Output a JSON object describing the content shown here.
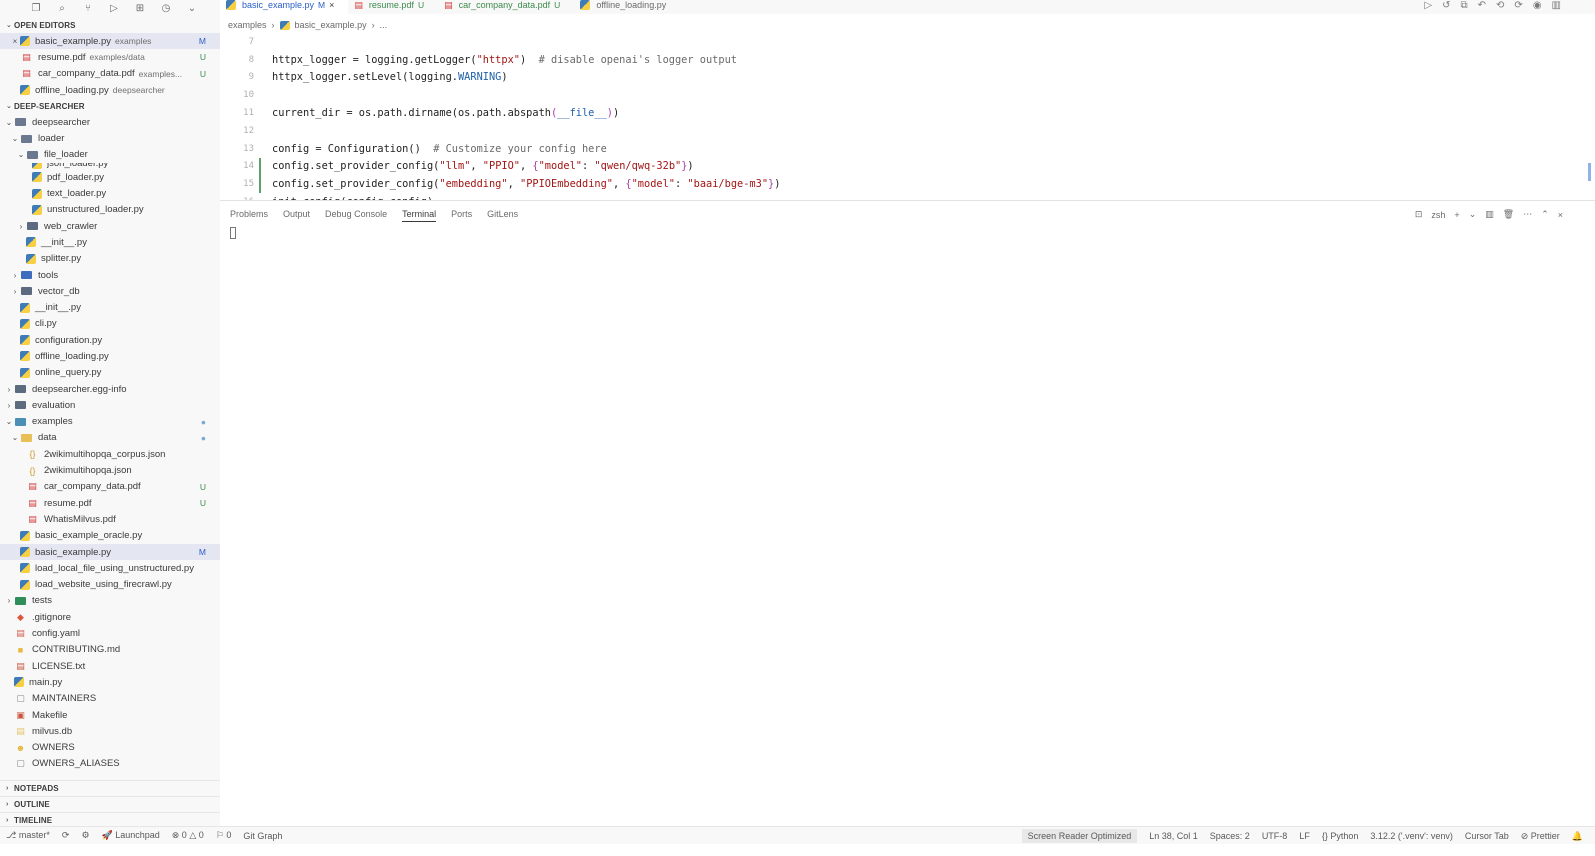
{
  "sidebar": {
    "activity_icons": [
      "copy-icon",
      "search-icon",
      "source-control-icon",
      "run-debug-icon",
      "extensions-icon",
      "timer-icon",
      "chevron-down-icon"
    ],
    "open_editors_title": "OPEN EDITORS",
    "open_editors": [
      {
        "name": "basic_example.py",
        "desc": "examples",
        "badge": "M",
        "status": "modified",
        "icon": "python",
        "close": true,
        "selected": true
      },
      {
        "name": "resume.pdf",
        "desc": "examples/data",
        "badge": "U",
        "status": "untracked",
        "icon": "pdf"
      },
      {
        "name": "car_company_data.pdf",
        "desc": "examples...",
        "badge": "U",
        "status": "untracked",
        "icon": "pdf"
      },
      {
        "name": "offline_loading.py",
        "desc": "deepsearcher",
        "badge": "",
        "status": "normal",
        "icon": "python"
      }
    ],
    "project_title": "DEEP-SEARCHER",
    "tree": [
      {
        "name": "deepsearcher",
        "depth": 0,
        "type": "folder-open"
      },
      {
        "name": "loader",
        "depth": 1,
        "type": "folder-open"
      },
      {
        "name": "file_loader",
        "depth": 2,
        "type": "folder-open"
      },
      {
        "name": "json_loader.py",
        "depth": 3,
        "type": "python",
        "partial": true
      },
      {
        "name": "pdf_loader.py",
        "depth": 3,
        "type": "python"
      },
      {
        "name": "text_loader.py",
        "depth": 3,
        "type": "python"
      },
      {
        "name": "unstructured_loader.py",
        "depth": 3,
        "type": "python"
      },
      {
        "name": "web_crawler",
        "depth": 2,
        "type": "folder"
      },
      {
        "name": "__init__.py",
        "depth": 2,
        "type": "python"
      },
      {
        "name": "splitter.py",
        "depth": 2,
        "type": "python"
      },
      {
        "name": "tools",
        "depth": 1,
        "type": "folder-tools"
      },
      {
        "name": "vector_db",
        "depth": 1,
        "type": "folder"
      },
      {
        "name": "__init__.py",
        "depth": 1,
        "type": "python"
      },
      {
        "name": "cli.py",
        "depth": 1,
        "type": "python"
      },
      {
        "name": "configuration.py",
        "depth": 1,
        "type": "python"
      },
      {
        "name": "offline_loading.py",
        "depth": 1,
        "type": "python"
      },
      {
        "name": "online_query.py",
        "depth": 1,
        "type": "python"
      },
      {
        "name": "deepsearcher.egg-info",
        "depth": 0,
        "type": "folder",
        "dim": true
      },
      {
        "name": "evaluation",
        "depth": 0,
        "type": "folder"
      },
      {
        "name": "examples",
        "depth": 0,
        "type": "folder-examples",
        "open": true,
        "status": "modified",
        "dot": true
      },
      {
        "name": "data",
        "depth": 1,
        "type": "folder-data",
        "open": true,
        "status": "untracked",
        "dot": true
      },
      {
        "name": "2wikimultihopqa_corpus.json",
        "depth": 2,
        "type": "json"
      },
      {
        "name": "2wikimultihopqa.json",
        "depth": 2,
        "type": "json"
      },
      {
        "name": "car_company_data.pdf",
        "depth": 2,
        "type": "pdf",
        "status": "untracked",
        "badge": "U"
      },
      {
        "name": "resume.pdf",
        "depth": 2,
        "type": "pdf",
        "status": "untracked",
        "badge": "U"
      },
      {
        "name": "WhatisMilvus.pdf",
        "depth": 2,
        "type": "pdf"
      },
      {
        "name": "basic_example_oracle.py",
        "depth": 1,
        "type": "python"
      },
      {
        "name": "basic_example.py",
        "depth": 1,
        "type": "python",
        "status": "modified",
        "badge": "M",
        "selected": true
      },
      {
        "name": "load_local_file_using_unstructured.py",
        "depth": 1,
        "type": "python"
      },
      {
        "name": "load_website_using_firecrawl.py",
        "depth": 1,
        "type": "python"
      },
      {
        "name": "tests",
        "depth": 0,
        "type": "folder-tests"
      },
      {
        "name": ".gitignore",
        "depth": 0,
        "type": "git"
      },
      {
        "name": "config.yaml",
        "depth": 0,
        "type": "yaml"
      },
      {
        "name": "CONTRIBUTING.md",
        "depth": 0,
        "type": "md"
      },
      {
        "name": "LICENSE.txt",
        "depth": 0,
        "type": "license"
      },
      {
        "name": "main.py",
        "depth": 0,
        "type": "python"
      },
      {
        "name": "MAINTAINERS",
        "depth": 0,
        "type": "file"
      },
      {
        "name": "Makefile",
        "depth": 0,
        "type": "makefile"
      },
      {
        "name": "milvus.db",
        "depth": 0,
        "type": "db",
        "dim": true
      },
      {
        "name": "OWNERS",
        "depth": 0,
        "type": "owners"
      },
      {
        "name": "OWNERS_ALIASES",
        "depth": 0,
        "type": "file"
      }
    ],
    "bottom_sections": [
      "NOTEPADS",
      "OUTLINE",
      "TIMELINE"
    ]
  },
  "tabs": [
    {
      "name": "basic_example.py",
      "flag": "M",
      "status": "modified",
      "icon": "python",
      "active": true,
      "close": "×"
    },
    {
      "name": "resume.pdf",
      "flag": "U",
      "status": "untracked",
      "icon": "pdf"
    },
    {
      "name": "car_company_data.pdf",
      "flag": "U",
      "status": "untracked",
      "icon": "pdf"
    },
    {
      "name": "offline_loading.py",
      "flag": "",
      "status": "plain",
      "icon": "python"
    }
  ],
  "editor_action_icons": [
    "run-icon",
    "history-icon",
    "compare-icon",
    "revert-icon",
    "back-icon",
    "forward-icon",
    "preview-icon",
    "split-icon"
  ],
  "breadcrumb": {
    "folder": "examples",
    "sep": "›",
    "file": "basic_example.py",
    "more": "..."
  },
  "code_lines": [
    {
      "n": "7",
      "changed": false,
      "html": ""
    },
    {
      "n": "8",
      "changed": false,
      "html": "httpx_logger = logging.getLogger(<s>\"httpx\"</s>)  <c># disable openai's logger output</c>"
    },
    {
      "n": "9",
      "changed": false,
      "html": "httpx_logger.setLevel(logging.<k>WARNING</k>)"
    },
    {
      "n": "10",
      "changed": false,
      "html": ""
    },
    {
      "n": "11",
      "changed": false,
      "html": "current_dir = os.path.dirname(os.path.abspath<b2>(</b2><k>__file__</k><b2>)</b2>)"
    },
    {
      "n": "12",
      "changed": false,
      "html": ""
    },
    {
      "n": "13",
      "changed": false,
      "html": "config = Configuration()  <c># Customize your config here</c>"
    },
    {
      "n": "14",
      "changed": true,
      "html": "config.set_provider_config(<s>\"llm\"</s>, <s>\"PPIO\"</s>, <b2>{</b2><s>\"model\"</s>: <s>\"qwen/qwq-32b\"</s><b2>}</b2>)"
    },
    {
      "n": "15",
      "changed": true,
      "html": "config.set_provider_config(<s>\"embedding\"</s>, <s>\"PPIOEmbedding\"</s>, <b2>{</b2><s>\"model\"</s>: <s>\"baai/bge-m3\"</s><b2>}</b2>)"
    },
    {
      "n": "16",
      "changed": false,
      "html": "init_config(config=config)"
    }
  ],
  "panel": {
    "tabs": [
      "Problems",
      "Output",
      "Debug Console",
      "Terminal",
      "Ports",
      "GitLens"
    ],
    "active": "Terminal",
    "shell": "zsh",
    "action_icons": [
      "terminal-icon",
      "add-icon",
      "chevron-down-icon",
      "split-icon",
      "trash-icon",
      "more-icon",
      "maximize-icon",
      "close-icon"
    ]
  },
  "status": {
    "left": [
      {
        "text": "⎇ master*",
        "name": "branch-status"
      },
      {
        "text": "⟳",
        "name": "sync-icon"
      },
      {
        "text": "⚙",
        "name": "remote-icon"
      },
      {
        "text": "🚀 Launchpad",
        "name": "launchpad-status"
      },
      {
        "text": "⊗ 0 △ 0",
        "name": "problems-status"
      },
      {
        "text": "⚐ 0",
        "name": "ports-status"
      },
      {
        "text": "Git Graph",
        "name": "git-graph-status"
      }
    ],
    "right": [
      {
        "text": "Screen Reader Optimized",
        "name": "screen-reader-status",
        "sr": true
      },
      {
        "text": "Ln 38, Col 1",
        "name": "cursor-position-status"
      },
      {
        "text": "Spaces: 2",
        "name": "indent-status"
      },
      {
        "text": "UTF-8",
        "name": "encoding-status"
      },
      {
        "text": "LF",
        "name": "eol-status"
      },
      {
        "text": "{} Python",
        "name": "language-status"
      },
      {
        "text": "3.12.2 ('.venv': venv)",
        "name": "interpreter-status"
      },
      {
        "text": "Cursor Tab",
        "name": "cursor-tab-status"
      },
      {
        "text": "⊘ Prettier",
        "name": "prettier-status"
      },
      {
        "text": "🔔",
        "name": "bell-icon"
      }
    ]
  }
}
